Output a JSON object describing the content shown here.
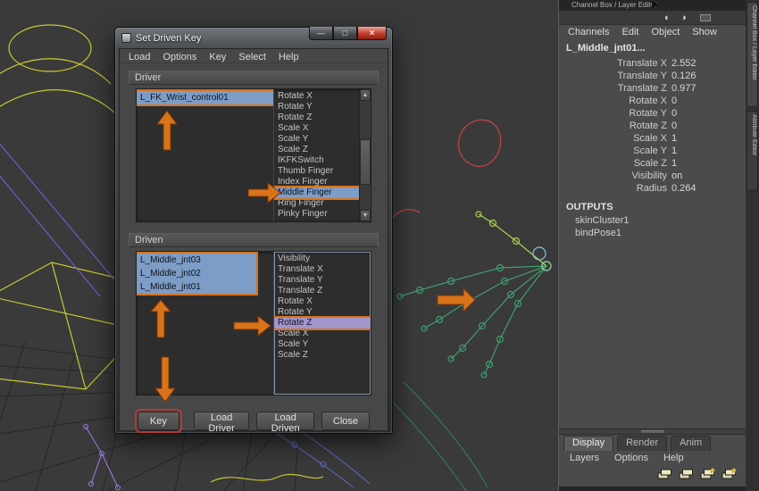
{
  "colors": {
    "annotation_orange": "#d9731a",
    "selection_blue": "#7d9cc6",
    "selection_purple": "#a295cc",
    "key_outline_red": "#b23b30"
  },
  "icons": {
    "minimize": "—",
    "maximize": "□",
    "close": "×",
    "scroll_up": "▲",
    "scroll_down": "▼",
    "gauge": "◐",
    "contrast": "◑"
  },
  "dialog": {
    "title": "Set Driven Key",
    "menus": [
      "Load",
      "Options",
      "Key",
      "Select",
      "Help"
    ],
    "driver": {
      "label": "Driver",
      "objects": [
        "L_FK_Wrist_control01"
      ],
      "selected_object": "L_FK_Wrist_control01",
      "attributes": [
        "Rotate X",
        "Rotate Y",
        "Rotate Z",
        "Scale X",
        "Scale Y",
        "Scale Z",
        "IKFKSwitch",
        "Thumb Finger",
        "Index Finger",
        "Middle Finger",
        "Ring Finger",
        "Pinky Finger"
      ],
      "selected_attribute": "Middle Finger"
    },
    "driven": {
      "label": "Driven",
      "objects": [
        "L_Middle_jnt03",
        "L_Middle_jnt02",
        "L_Middle_jnt01"
      ],
      "attributes": [
        "Visibility",
        "Translate X",
        "Translate Y",
        "Translate Z",
        "Rotate X",
        "Rotate Y",
        "Rotate Z",
        "Scale X",
        "Scale Y",
        "Scale Z"
      ],
      "selected_attribute": "Rotate Z"
    },
    "buttons": [
      "Key",
      "Load Driver",
      "Load Driven",
      "Close"
    ]
  },
  "channel_box": {
    "header": "Channel Box / Layer Editor",
    "menus": [
      "Channels",
      "Edit",
      "Object",
      "Show"
    ],
    "object_name": "L_Middle_jnt01...",
    "attributes": [
      {
        "name": "Translate X",
        "value": "2.552"
      },
      {
        "name": "Translate Y",
        "value": "0.126"
      },
      {
        "name": "Translate Z",
        "value": "0.977"
      },
      {
        "name": "Rotate X",
        "value": "0"
      },
      {
        "name": "Rotate Y",
        "value": "0"
      },
      {
        "name": "Rotate Z",
        "value": "0"
      },
      {
        "name": "Scale X",
        "value": "1"
      },
      {
        "name": "Scale Y",
        "value": "1"
      },
      {
        "name": "Scale Z",
        "value": "1"
      },
      {
        "name": "Visibility",
        "value": "on"
      },
      {
        "name": "Radius",
        "value": "0.264"
      }
    ],
    "outputs_label": "OUTPUTS",
    "outputs": [
      "skinCluster1",
      "bindPose1"
    ],
    "layer_tabs": [
      "Display",
      "Render",
      "Anim"
    ],
    "layer_menus": [
      "Layers",
      "Options",
      "Help"
    ]
  },
  "side_tabs": [
    "Channel Box / Layer Editor",
    "Attribute Editor"
  ]
}
